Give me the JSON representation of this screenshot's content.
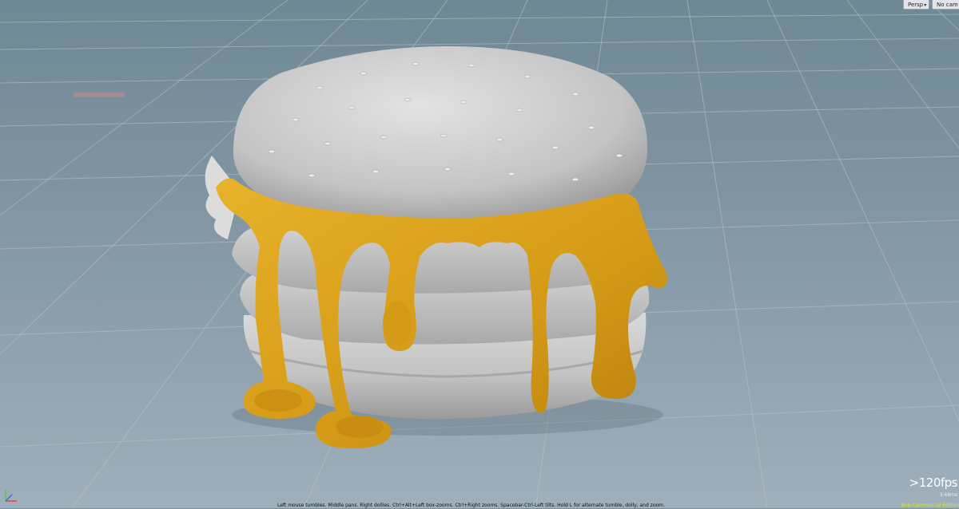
{
  "viewport": {
    "view_menu": {
      "label": "Persp",
      "chevron": "▾",
      "icon": "chevron-down-icon"
    },
    "camera_menu": {
      "label": "No cam",
      "chevron": "▾",
      "icon": "chevron-down-icon"
    },
    "fps": ">120fps",
    "frame_time": "3.68ms",
    "license": "Non-Commercial Edition",
    "status_hint": "Left mouse tumbles. Middle pans. Right dollies. Ctrl+Alt+Left box-zooms. Ctrl+Right zooms. Spacebar-Ctrl-Left tilts. Hold L for alternate tumble, dolly, and zoom.",
    "axis_gizmo_icon": "axis-gizmo-icon",
    "colors": {
      "background_top": "#6f8896",
      "background_bottom": "#9fb0bc",
      "grid_line": "#b8c6cf",
      "model_surface": "#c9c9c9",
      "cheese": "#d9a21c",
      "fps_text": "#ffffff",
      "license_text": "#d6e43a",
      "axis_x": "#d94a3a",
      "axis_y": "#4ccf4a",
      "axis_z": "#3a6fd9"
    }
  }
}
